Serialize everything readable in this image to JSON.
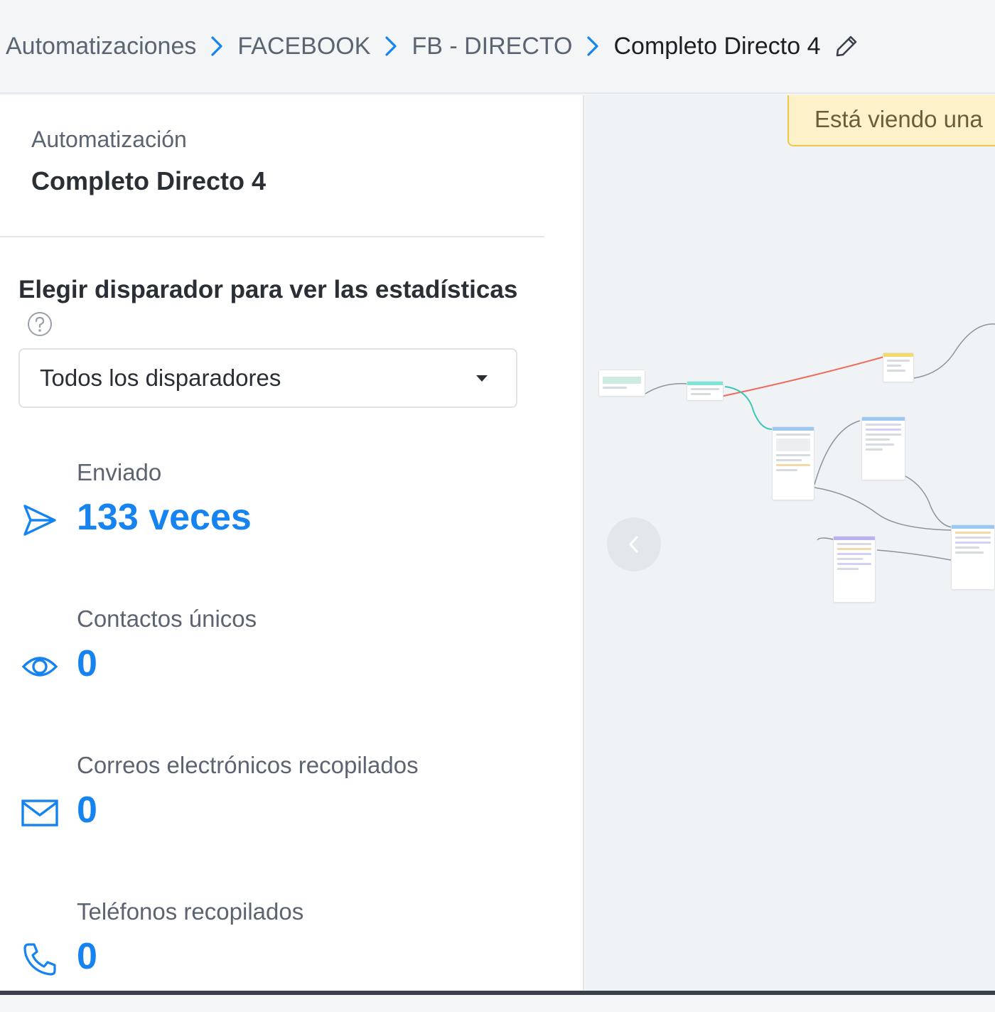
{
  "breadcrumb": {
    "items": [
      "Automatizaciones",
      "FACEBOOK",
      "FB - DIRECTO"
    ],
    "current": "Completo Directo 4"
  },
  "panel": {
    "automation_label": "Automatización",
    "automation_name": "Completo Directo 4",
    "trigger_title": "Elegir disparador para ver las estadísticas",
    "trigger_select_value": "Todos los disparadores"
  },
  "stats": [
    {
      "label": "Enviado",
      "value": "133 veces",
      "icon": "send-icon"
    },
    {
      "label": "Contactos únicos",
      "value": "0",
      "icon": "eye-icon"
    },
    {
      "label": "Correos electrónicos recopilados",
      "value": "0",
      "icon": "mail-icon"
    },
    {
      "label": "Teléfonos recopilados",
      "value": "0",
      "icon": "phone-icon"
    }
  ],
  "canvas": {
    "banner_text": "Está viendo una"
  },
  "colors": {
    "accent": "#1583f0",
    "banner_bg": "#fdf1c9",
    "banner_border": "#f0c64d",
    "edge_red": "#ef6b5b",
    "edge_teal": "#3cc7b3",
    "edge_gray": "#8c939c"
  }
}
